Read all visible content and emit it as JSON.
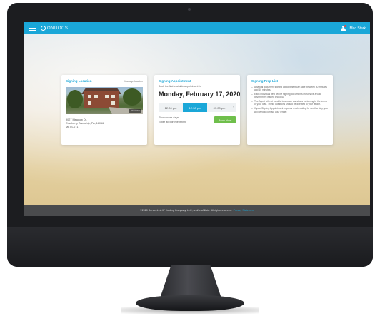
{
  "header": {
    "logo_text": "ONDOCS",
    "user_name": "Mac Stark"
  },
  "location_card": {
    "title": "Signing Location",
    "manage_link": "Manage location",
    "photo_tag": "Street View",
    "address_line1": "9027 Meadow Dr.",
    "address_line2": "Cranberry Township, PA, 16066",
    "address_line3": "MLTS-071"
  },
  "appointment_card": {
    "title": "Signing Appointment",
    "subtitle": "Book the first available appointment for",
    "date": "Monday, February 17, 2020",
    "slots": [
      "12:00 pm",
      "12:30 pm",
      "01:00 pm"
    ],
    "next_arrow": "›",
    "show_more": "Show more days",
    "enter_time": "Enter appointment time",
    "book_button": "Book Now"
  },
  "prep_card": {
    "title": "Signing Prep List",
    "items": [
      "A typical document signing appointment can take between 30 minutes and 60 minutes.",
      "Each individual who will be signing documents must have a valid government issued photo ID.",
      "The Agent will not be able to answer questions pertaining to the terms of your loan. These questions should be directed to your lender.",
      "If your Signing Appointment requires rescheduling for another day, you will need to contact your lender."
    ]
  },
  "footer": {
    "text": "©2020 ServiceLink IP Holding Company, LLC, and/or affiliate. All rights reserved.",
    "link": "Privacy Statement"
  },
  "colors": {
    "accent": "#1aa7d8",
    "book_button": "#6fbf4b",
    "footer_bg": "#4a4b4d"
  }
}
